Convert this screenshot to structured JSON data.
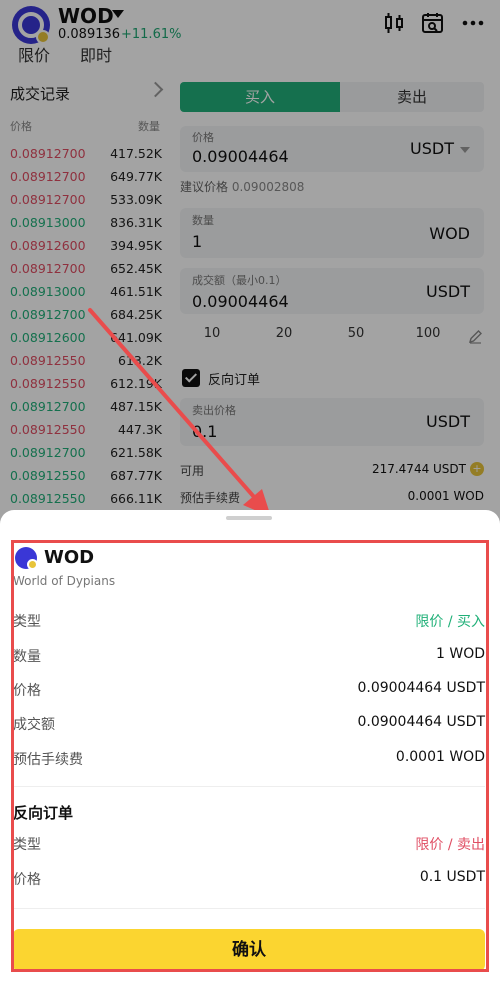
{
  "header": {
    "coin": "WOD",
    "price": "0.089136",
    "change": "+11.61%",
    "tabs": [
      "限价",
      "即时"
    ]
  },
  "history": {
    "title": "成交记录",
    "col_price": "价格",
    "col_qty": "数量",
    "rows": [
      {
        "p": "0.08912700",
        "q": "417.52K",
        "side": "sell"
      },
      {
        "p": "0.08912700",
        "q": "649.77K",
        "side": "sell"
      },
      {
        "p": "0.08912700",
        "q": "533.09K",
        "side": "sell"
      },
      {
        "p": "0.08913000",
        "q": "836.31K",
        "side": "buy"
      },
      {
        "p": "0.08912600",
        "q": "394.95K",
        "side": "sell"
      },
      {
        "p": "0.08912700",
        "q": "652.45K",
        "side": "sell"
      },
      {
        "p": "0.08913000",
        "q": "461.51K",
        "side": "buy"
      },
      {
        "p": "0.08912700",
        "q": "684.25K",
        "side": "buy"
      },
      {
        "p": "0.08912600",
        "q": "641.09K",
        "side": "buy"
      },
      {
        "p": "0.08912550",
        "q": "613.2K",
        "side": "sell"
      },
      {
        "p": "0.08912550",
        "q": "612.19K",
        "side": "sell"
      },
      {
        "p": "0.08912700",
        "q": "487.15K",
        "side": "buy"
      },
      {
        "p": "0.08912550",
        "q": "447.3K",
        "side": "sell"
      },
      {
        "p": "0.08912700",
        "q": "621.58K",
        "side": "buy"
      },
      {
        "p": "0.08912550",
        "q": "687.77K",
        "side": "buy"
      },
      {
        "p": "0.08912550",
        "q": "666.11K",
        "side": "buy"
      }
    ]
  },
  "order": {
    "buy_tab": "买入",
    "sell_tab": "卖出",
    "price_label": "价格",
    "price_value": "0.09004464",
    "price_unit": "USDT",
    "suggest_label": "建议价格",
    "suggest_value": "0.09002808",
    "qty_label": "数量",
    "qty_value": "1",
    "qty_unit": "WOD",
    "amount_label": "成交额（最小0.1）",
    "amount_value": "0.09004464",
    "amount_unit": "USDT",
    "presets": [
      "10",
      "20",
      "50",
      "100"
    ],
    "reverse_label": "反向订单",
    "sell_price_label": "卖出价格",
    "sell_price_value": "0.1",
    "sell_price_unit": "USDT",
    "available_label": "可用",
    "available_value": "217.4744 USDT",
    "fee_label": "预估手续费",
    "fee_value": "0.0001 WOD"
  },
  "sheet": {
    "title": "WOD",
    "subtitle": "World of Dypians",
    "rows": [
      {
        "k": "类型",
        "v": "限价 / 买入"
      },
      {
        "k": "数量",
        "v": "1 WOD"
      },
      {
        "k": "价格",
        "v": "0.09004464 USDT"
      },
      {
        "k": "成交额",
        "v": "0.09004464 USDT"
      },
      {
        "k": "预估手续费",
        "v": "0.0001 WOD"
      }
    ],
    "reverse_title": "反向订单",
    "reverse_rows": [
      {
        "k": "类型",
        "v": "限价 / 卖出"
      },
      {
        "k": "价格",
        "v": "0.1 USDT"
      }
    ],
    "confirm_label": "确认"
  },
  "colors": {
    "buy_green": "#21b07a",
    "sell_red": "#e04e63",
    "confirm_yellow": "#fbd530",
    "highlight_red": "#e94c4c"
  }
}
